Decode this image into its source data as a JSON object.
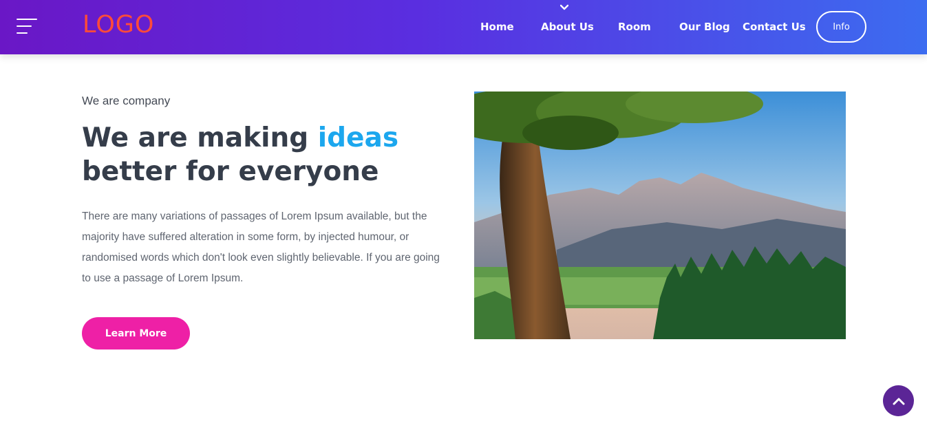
{
  "header": {
    "logo_text": "LOGO",
    "nav": [
      {
        "label": "Home"
      },
      {
        "label": "About Us"
      },
      {
        "label": "Room"
      },
      {
        "label": "Our Blog"
      },
      {
        "label": "Contact Us"
      }
    ],
    "info_label": "Info",
    "gradient_start": "#6a17c6",
    "gradient_end": "#3c6cf0"
  },
  "hero": {
    "eyebrow": "We are company",
    "headline_part1": "We are making ",
    "headline_accent": "ideas",
    "headline_part2": "better for everyone",
    "body": "There are many variations of passages of Lorem Ipsum available, but the majority have suffered alteration in some form, by injected humour, or randomised words which don't look even slightly believable. If you are going to use a passage of Lorem Ipsum.",
    "button_label": "Learn More",
    "accent_color": "#1ca7ee",
    "button_color": "#ee20a6"
  },
  "icons": {
    "menu": "hamburger-menu-icon",
    "dropdown": "chevron-down-icon",
    "scroll_top": "chevron-up-icon"
  }
}
